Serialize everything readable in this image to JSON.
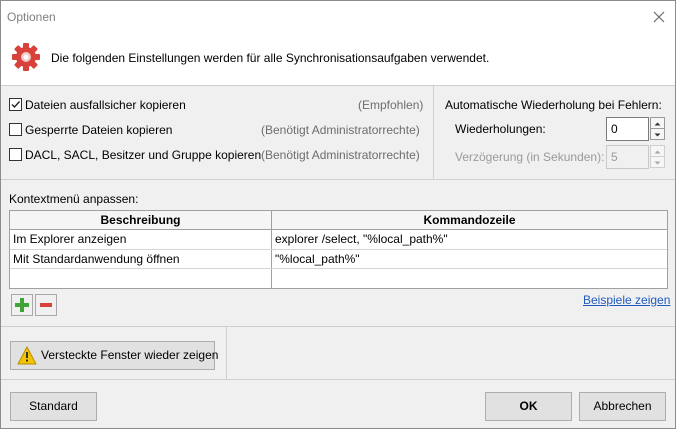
{
  "window": {
    "title": "Optionen"
  },
  "banner": {
    "text": "Die folgenden Einstellungen werden für alle Synchronisationsaufgaben verwendet."
  },
  "options": [
    {
      "label": "Dateien ausfallsicher kopieren",
      "hint": "(Empfohlen)",
      "checked": true
    },
    {
      "label": "Gesperrte Dateien kopieren",
      "hint": "(Benötigt Administratorrechte)",
      "checked": false
    },
    {
      "label": "DACL, SACL, Besitzer und Gruppe kopieren",
      "hint": "(Benötigt Administratorrechte)",
      "checked": false
    }
  ],
  "retry": {
    "heading": "Automatische Wiederholung bei Fehlern:",
    "retries_label": "Wiederholungen:",
    "retries_value": "0",
    "delay_label": "Verzögerung (in Sekunden):",
    "delay_value": "5"
  },
  "context_menu": {
    "heading": "Kontextmenü anpassen:",
    "columns": [
      "Beschreibung",
      "Kommandozeile"
    ],
    "rows": [
      [
        "Im Explorer anzeigen",
        "explorer /select, \"%local_path%\""
      ],
      [
        "Mit Standardanwendung öffnen",
        "\"%local_path%\""
      ]
    ],
    "examples_link": "Beispiele zeigen"
  },
  "hidden_windows_button": "Versteckte Fenster wieder zeigen",
  "footer": {
    "default_button": "Standard",
    "ok_button": "OK",
    "cancel_button": "Abbrechen"
  },
  "colors": {
    "link": "#1f5bbf",
    "gear_icon": "#d9413b",
    "add_icon": "#3fa535",
    "remove_icon": "#d9413b",
    "warning_icon": "#f5c400"
  }
}
